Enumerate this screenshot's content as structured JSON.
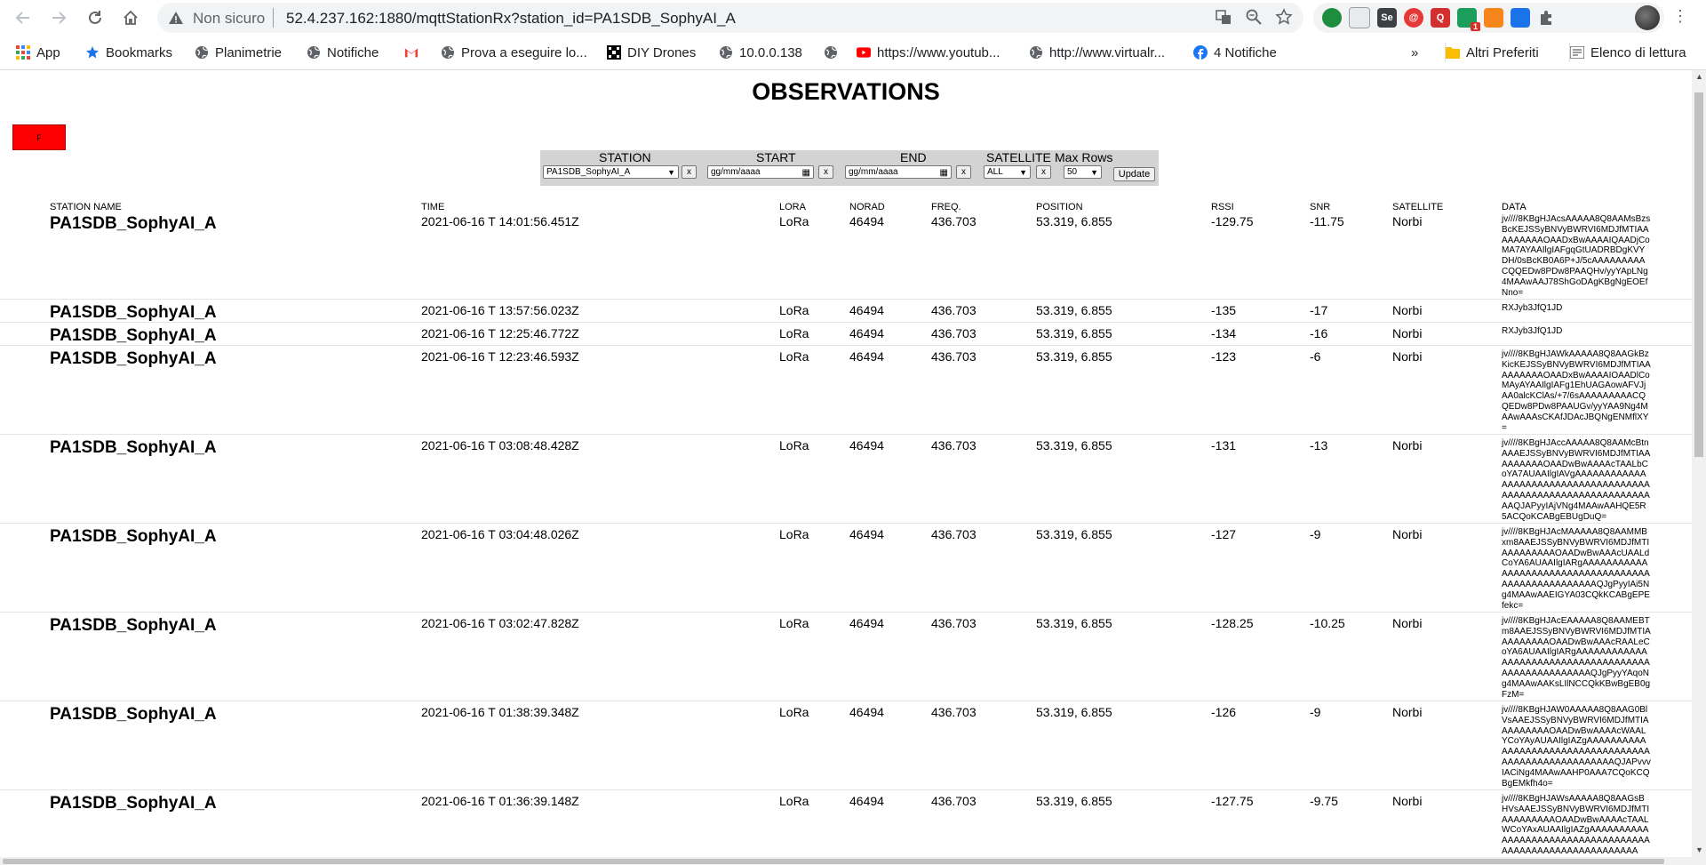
{
  "browser": {
    "security_label": "Non sicuro",
    "url": "52.4.237.162:1880/mqttStationRx?station_id=PA1SDB_SophyAI_A",
    "bookmarks": [
      {
        "label": "App",
        "icon": "apps-grid-icon"
      },
      {
        "label": "Bookmarks",
        "icon": "star-icon"
      },
      {
        "label": "Planimetrie",
        "icon": "globe-icon"
      },
      {
        "label": "Notifiche",
        "icon": "globe-icon"
      },
      {
        "label": "",
        "icon": "gmail-icon"
      },
      {
        "label": "Prova a eseguire lo...",
        "icon": "globe-icon"
      },
      {
        "label": "DIY Drones",
        "icon": "diy-drones-icon"
      },
      {
        "label": "10.0.0.138",
        "icon": "globe-icon"
      },
      {
        "label": "",
        "icon": "globe-icon"
      },
      {
        "label": "https://www.youtub...",
        "icon": "youtube-icon"
      },
      {
        "label": "http://www.virtualr...",
        "icon": "globe-icon"
      },
      {
        "label": "4 Notifiche",
        "icon": "facebook-icon"
      }
    ],
    "more_label": "»",
    "other_bookmarks": "Altri Preferiti",
    "reading_list": "Elenco di lettura",
    "extension_badge": "1"
  },
  "page": {
    "title": "OBSERVATIONS",
    "red_button_label": "F",
    "filter": {
      "station_label": "STATION",
      "start_label": "START",
      "end_label": "END",
      "satellite_label": "SATELLITE",
      "max_rows_label": "Max Rows",
      "station_value": "PA1SDB_SophyAI_A",
      "start_placeholder": "gg/mm/aaaa",
      "end_placeholder": "gg/mm/aaaa",
      "satellite_value": "ALL",
      "max_rows_value": "50",
      "clear_label": "x",
      "update_label": "Update"
    },
    "columns": {
      "station_name": "STATION NAME",
      "time": "TIME",
      "lora": "LORA",
      "norad": "NORAD",
      "freq": "FREQ.",
      "position": "POSITION",
      "rssi": "RSSI",
      "snr": "SNR",
      "satellite": "SATELLITE",
      "data": "DATA"
    },
    "rows": [
      {
        "station": "PA1SDB_SophyAI_A",
        "time": "2021-06-16 T 14:01:56.451Z",
        "lora": "LoRa",
        "norad": "46494",
        "freq": "436.703",
        "position": "53.319, 6.855",
        "rssi": "-129.75",
        "snr": "-11.75",
        "satellite": "Norbi",
        "data": "jv////8KBgHJAcsAAAAA8Q8AAMsBzsBcKEJSSyBNVyBWRVI6MDJfMTIAAAAAAAAAOAADxBwAAAAIQAADjCoMA7AYAAIlgIAFgqGtUADRBDgKVYDH/0sBcKB0A6P+J/5cAAAAAAAAACQQEDw8PDw8PAAQHv/yyYApLNg4MAAwAAJ78ShGoDAgKBgNgEOEfNno="
      },
      {
        "station": "PA1SDB_SophyAI_A",
        "time": "2021-06-16 T 13:57:56.023Z",
        "lora": "LoRa",
        "norad": "46494",
        "freq": "436.703",
        "position": "53.319, 6.855",
        "rssi": "-135",
        "snr": "-17",
        "satellite": "Norbi",
        "data": "RXJyb3JfQ1JD"
      },
      {
        "station": "PA1SDB_SophyAI_A",
        "time": "2021-06-16 T 12:25:46.772Z",
        "lora": "LoRa",
        "norad": "46494",
        "freq": "436.703",
        "position": "53.319, 6.855",
        "rssi": "-134",
        "snr": "-16",
        "satellite": "Norbi",
        "data": "RXJyb3JfQ1JD"
      },
      {
        "station": "PA1SDB_SophyAI_A",
        "time": "2021-06-16 T 12:23:46.593Z",
        "lora": "LoRa",
        "norad": "46494",
        "freq": "436.703",
        "position": "53.319, 6.855",
        "rssi": "-123",
        "snr": "-6",
        "satellite": "Norbi",
        "data": "jv////8KBgHJAWkAAAAA8Q8AAGkBzKicKEJSSyBNVyBWRVI6MDJfMTIAAAAAAAAAOAADxBwAAAAIOAADlCoMAyAYAAIlgIAFg1EhUAGAowAFVJjAA0alcKClAs/+7/6sAAAAAAAAACQQEDw8PDw8PAAUGv/yyYAA9Ng4MAAwAAAsCKAfJDAcJBQNgENMflXY="
      },
      {
        "station": "PA1SDB_SophyAI_A",
        "time": "2021-06-16 T 03:08:48.428Z",
        "lora": "LoRa",
        "norad": "46494",
        "freq": "436.703",
        "position": "53.319, 6.855",
        "rssi": "-131",
        "snr": "-13",
        "satellite": "Norbi",
        "data": "jv////8KBgHJAccAAAAA8Q8AAMcBtnAAAEJSSyBNVyBWRVI6MDJfMTIAAAAAAAAAOAADwBwAAAAcTAALbCoYA7AUAAIlgIAVgAAAAAAAAAAAAAAAAAAAAAAAAAAAAAAAAAAAAAAAAAAAAAAAAAAAAAAAAAAAAAAAAQJAPyyIAjVNg4MAAwAAHQE5R5ACQoKCABgEBUgDuQ="
      },
      {
        "station": "PA1SDB_SophyAI_A",
        "time": "2021-06-16 T 03:04:48.026Z",
        "lora": "LoRa",
        "norad": "46494",
        "freq": "436.703",
        "position": "53.319, 6.855",
        "rssi": "-127",
        "snr": "-9",
        "satellite": "Norbi",
        "data": "jv////8KBgHJAcMAAAAA8Q8AAMMBxm8AAEJSSyBNVyBWRVI6MDJfMTIAAAAAAAAAOAADwBwAAAcUAALdCoYA6AUAAIlgIARgAAAAAAAAAAAAAAAAAAAAAAAAAAAAAAAAAAAAAAAAAAAAAAAAAAAAQJgPyyIAi5Ng4MAAwAAEIGYA03CQkKCABgEPEfekc="
      },
      {
        "station": "PA1SDB_SophyAI_A",
        "time": "2021-06-16 T 03:02:47.828Z",
        "lora": "LoRa",
        "norad": "46494",
        "freq": "436.703",
        "position": "53.319, 6.855",
        "rssi": "-128.25",
        "snr": "-10.25",
        "satellite": "Norbi",
        "data": "jv////8KBgHJAcEAAAAA8Q8AAMEBTm8AAEJSSyBNVyBWRVI6MDJfMTIAAAAAAAAAOAADwBwAAAcRAALeCoYA6AUAAIlgIARgAAAAAAAAAAAAAAAAAAAAAAAAAAAAAAAAAAAAAAAAAAAAAAAAAAAAQJgPyyYAqoNg4MAAwAAKsLIlNCCQkKBwBgEB0gFzM="
      },
      {
        "station": "PA1SDB_SophyAI_A",
        "time": "2021-06-16 T 01:38:39.348Z",
        "lora": "LoRa",
        "norad": "46494",
        "freq": "436.703",
        "position": "53.319, 6.855",
        "rssi": "-126",
        "snr": "-9",
        "satellite": "Norbi",
        "data": "jv////8KBgHJAW0AAAAA8Q8AAG0BlVsAAEJSSyBNVyBWRVI6MDJfMTIAAAAAAAAAOAADwBwAAAAcWAALYCoYAyAUAAIlgIAZgAAAAAAAAAAAAAAAAAAAAAAAAAAAAAAAAAAAAAAAAAAAAAAAAAAAAAAQJAPvvvIACiNg4MAAwAAHP0AAA7CQoKCQBgEMkfh4o="
      },
      {
        "station": "PA1SDB_SophyAI_A",
        "time": "2021-06-16 T 01:36:39.148Z",
        "lora": "LoRa",
        "norad": "46494",
        "freq": "436.703",
        "position": "53.319, 6.855",
        "rssi": "-127.75",
        "snr": "-9.75",
        "satellite": "Norbi",
        "data": "jv////8KBgHJAWsAAAAA8Q8AAGsBHVsAAEJSSyBNVyBWRVI6MDJfMTIAAAAAAAAAOAADwBwAAAAcTAALWCoYAxAUAAIlgIAZgAAAAAAAAAAAAAAAAAAAAAAAAAAAAAAAAAAAAAAAAAAAAAAAAAAAAAAAAAA"
      }
    ]
  }
}
